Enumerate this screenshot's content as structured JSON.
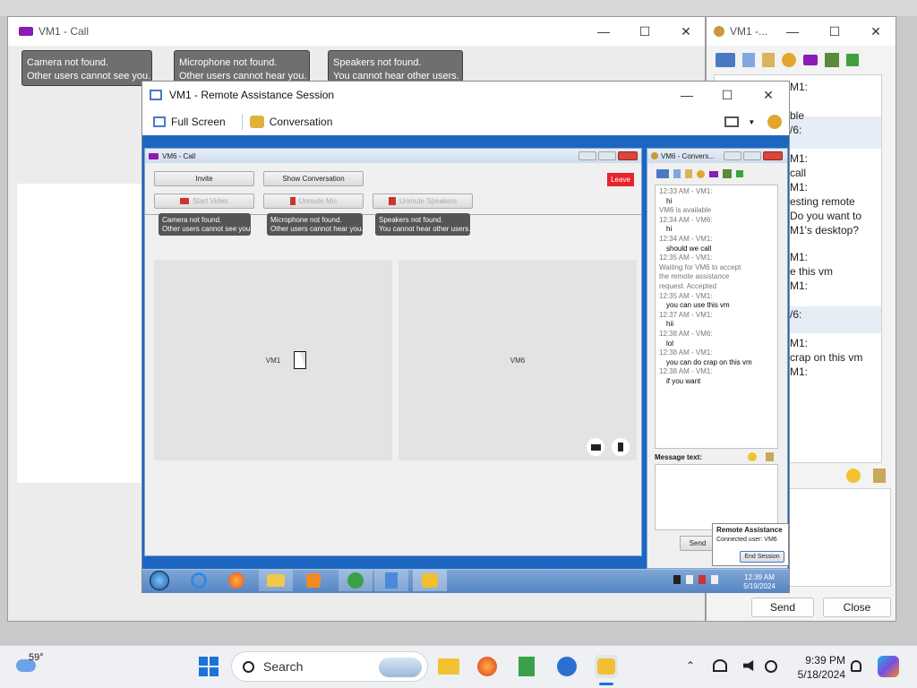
{
  "desktop": {
    "background": "#c9c9c9"
  },
  "vm1_call": {
    "title": "VM1 - Call",
    "tips": [
      {
        "line1": "Camera not found.",
        "line2": "Other users cannot see you."
      },
      {
        "line1": "Microphone not found.",
        "line2": "Other users cannot hear you."
      },
      {
        "line1": "Speakers not found.",
        "line2": "You cannot hear other users."
      }
    ]
  },
  "chat_right": {
    "title": "VM1 -...",
    "lines": [
      "M1:",
      "ble",
      "/6:",
      "M1:",
      "call",
      "M1:",
      "esting remote",
      "Do you want to",
      "M1's desktop?",
      "M1:",
      "e this vm",
      "M1:",
      "/6:",
      "M1:",
      "crap on this vm",
      "M1:"
    ],
    "send": "Send",
    "close": "Close"
  },
  "ra": {
    "title": "VM1 - Remote Assistance Session",
    "fullscreen": "Full Screen",
    "conversation": "Conversation"
  },
  "vm6_call": {
    "title": "VM6 - Call",
    "invite": "Invite",
    "show_conversation": "Show Conversation",
    "leave": "Leave",
    "start_video": "Start Video",
    "unmute_mic": "Unmute Mic",
    "unmute_speakers": "Unmute Speakers",
    "tips": [
      {
        "line1": "Camera not found.",
        "line2": "Other users cannot see you."
      },
      {
        "line1": "Microphone not found.",
        "line2": "Other users cannot hear you."
      },
      {
        "line1": "Speakers not found.",
        "line2": "You cannot hear other users."
      }
    ],
    "video_left": "VM1",
    "video_right": "VM6"
  },
  "vm6_conv": {
    "title": "VM6 - Convers...",
    "messages": [
      {
        "t": "hd",
        "text": "12:33 AM - VM1:"
      },
      {
        "t": "msg",
        "text": "hi"
      },
      {
        "t": "hd",
        "text": "VM6 is available"
      },
      {
        "t": "hd",
        "text": "12:34 AM - VM6:"
      },
      {
        "t": "msg",
        "text": "hi"
      },
      {
        "t": "hd",
        "text": "12:34 AM - VM1:"
      },
      {
        "t": "msg",
        "text": "should we call"
      },
      {
        "t": "hd",
        "text": "12:35 AM - VM1:"
      },
      {
        "t": "hd",
        "text": "   Waiting for VM6 to accept"
      },
      {
        "t": "hd",
        "text": "   the remote assistance"
      },
      {
        "t": "hd",
        "text": "   request. Accepted"
      },
      {
        "t": "hd",
        "text": "12:35 AM - VM1:"
      },
      {
        "t": "msg",
        "text": "you can use this vm"
      },
      {
        "t": "hd",
        "text": "12:37 AM - VM1:"
      },
      {
        "t": "msg",
        "text": "hii"
      },
      {
        "t": "hd",
        "text": "12:38 AM - VM6:"
      },
      {
        "t": "msg",
        "text": "lol"
      },
      {
        "t": "hd",
        "text": "12:38 AM - VM1:"
      },
      {
        "t": "msg",
        "text": "you can do crap on this vm"
      },
      {
        "t": "hd",
        "text": "12:38 AM - VM1:"
      },
      {
        "t": "msg",
        "text": "if you want"
      }
    ],
    "message_label": "Message text:",
    "send": "Send"
  },
  "ra_popup": {
    "title": "Remote Assistance",
    "connected": "Connected user: VM6",
    "end": "End Session"
  },
  "win7_taskbar": {
    "time": "12:39 AM",
    "date": "5/19/2024"
  },
  "win11_taskbar": {
    "weather": "59°",
    "search": "Search",
    "time": "9:39 PM",
    "date": "5/18/2024"
  }
}
